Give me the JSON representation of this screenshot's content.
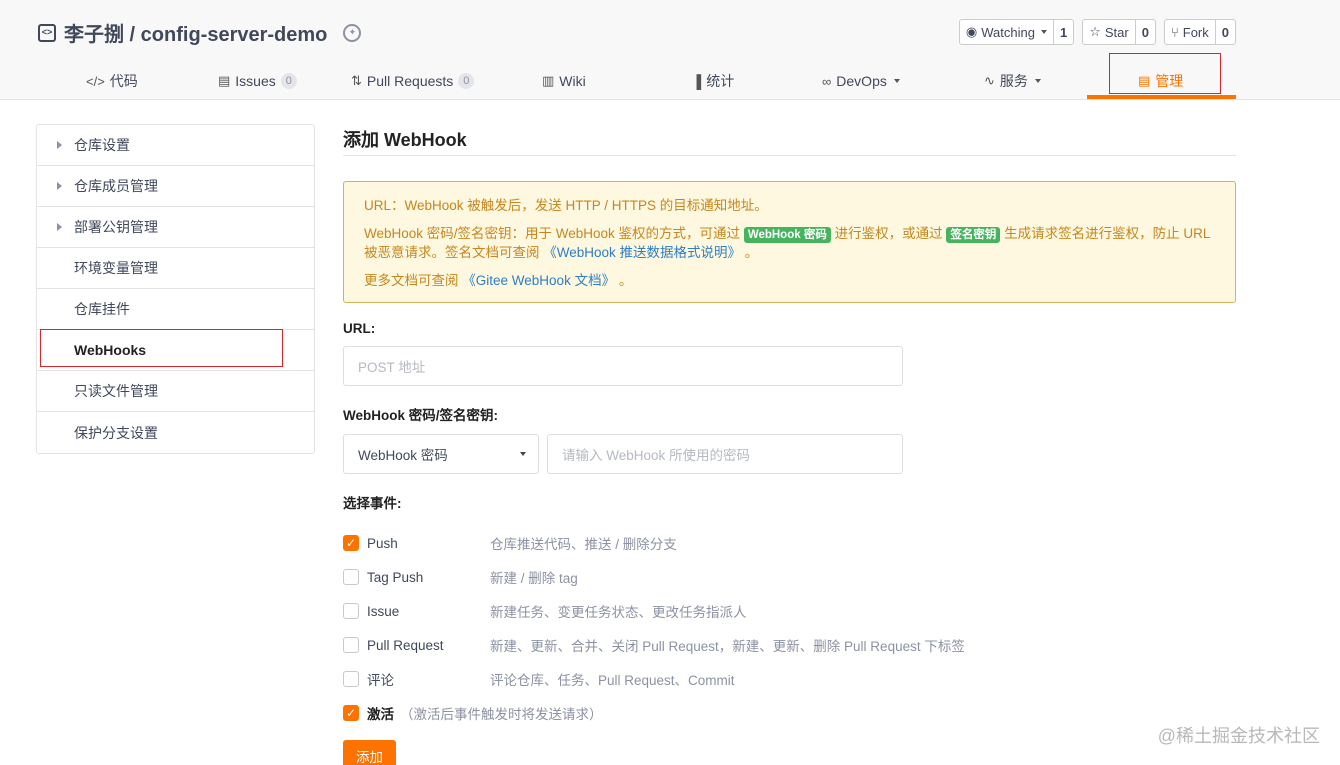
{
  "header": {
    "repo_name": "李子捌 / config-server-demo",
    "actions": [
      {
        "label": "Watching",
        "count": "1",
        "icon": "eye-icon"
      },
      {
        "label": "Star",
        "count": "0",
        "icon": "star-icon"
      },
      {
        "label": "Fork",
        "count": "0",
        "icon": "fork-icon"
      }
    ],
    "tabs": [
      {
        "label": "代码",
        "icon": "code-icon"
      },
      {
        "label": "Issues",
        "count": "0",
        "icon": "issues-icon"
      },
      {
        "label": "Pull Requests",
        "count": "0",
        "icon": "pull-request-icon"
      },
      {
        "label": "Wiki",
        "icon": "wiki-icon"
      },
      {
        "label": "统计",
        "icon": "stats-icon"
      },
      {
        "label": "DevOps",
        "icon": "devops-icon"
      },
      {
        "label": "服务",
        "icon": "pulse-icon"
      },
      {
        "label": "管理",
        "icon": "manage-icon",
        "active": true
      }
    ],
    "accent_color": "#fe7300"
  },
  "sidebar": {
    "items": [
      {
        "label": "仓库设置",
        "expandable": true
      },
      {
        "label": "仓库成员管理",
        "expandable": true
      },
      {
        "label": "部署公钥管理",
        "expandable": true
      },
      {
        "label": "环境变量管理"
      },
      {
        "label": "仓库挂件"
      },
      {
        "label": "WebHooks",
        "active": true
      },
      {
        "label": "只读文件管理"
      },
      {
        "label": "保护分支设置"
      }
    ]
  },
  "main": {
    "title": "添加 WebHook",
    "notice": {
      "line1": "URL：WebHook 被触发后，发送 HTTP / HTTPS 的目标通知地址。",
      "line2_a": "WebHook 密码/签名密钥：用于 WebHook 鉴权的方式，可通过 ",
      "tag1": "WebHook 密码",
      "line2_b": " 进行鉴权，或通过 ",
      "tag2": "签名密钥",
      "line2_c": " 生成请求签名进行鉴权，防止 URL 被恶意请求。签名文档可查阅 ",
      "link1": "《WebHook 推送数据格式说明》",
      "line2_d": " 。",
      "line3_a": "更多文档可查阅 ",
      "link2": "《Gitee WebHook 文档》",
      "line3_b": " 。"
    },
    "url_label": "URL:",
    "url_placeholder": "POST 地址",
    "secret_label": "WebHook 密码/签名密钥:",
    "secret_type": "WebHook 密码",
    "secret_placeholder": "请输入 WebHook 所使用的密码",
    "events_label": "选择事件:",
    "events": [
      {
        "name": "Push",
        "desc": "仓库推送代码、推送 / 删除分支",
        "checked": true
      },
      {
        "name": "Tag Push",
        "desc": "新建 / 删除 tag",
        "checked": false
      },
      {
        "name": "Issue",
        "desc": "新建任务、变更任务状态、更改任务指派人",
        "checked": false
      },
      {
        "name": "Pull Request",
        "desc": "新建、更新、合并、关闭 Pull Request，新建、更新、删除 Pull Request 下标签",
        "checked": false
      },
      {
        "name": "评论",
        "desc": "评论仓库、任务、Pull Request、Commit",
        "checked": false
      }
    ],
    "activate_label": "激活",
    "activate_hint": "（激活后事件触发时将发送请求）",
    "activate_checked": true,
    "submit_label": "添加"
  },
  "watermark": "@稀土掘金技术社区"
}
